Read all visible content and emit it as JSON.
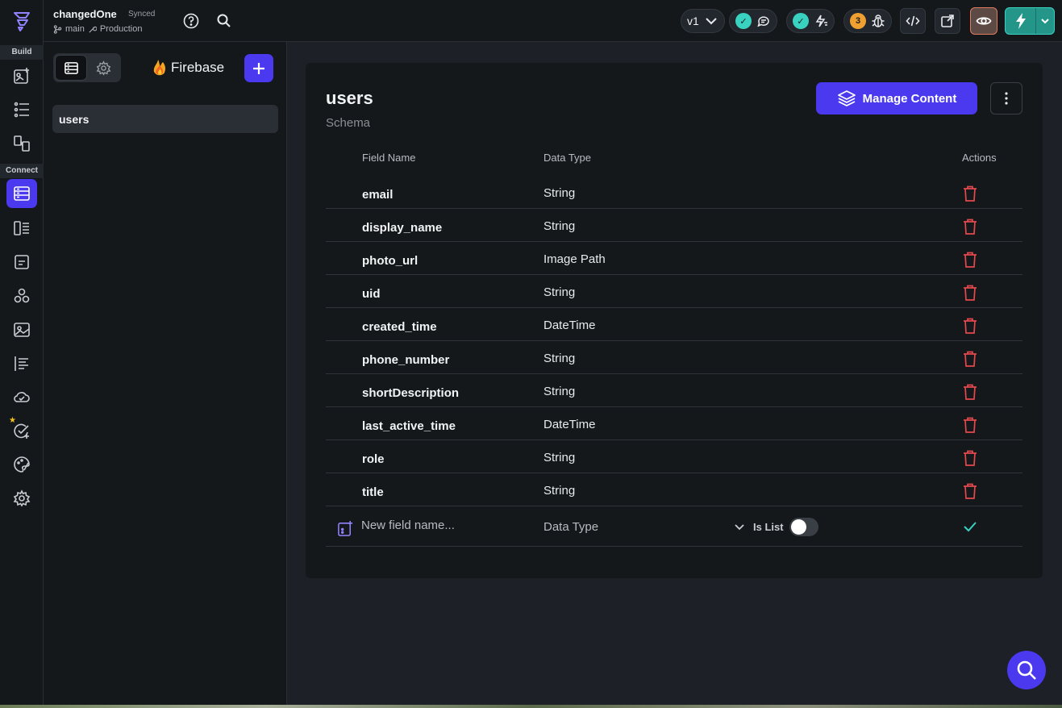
{
  "topbar": {
    "project_name": "changedOne",
    "sync_status": "Synced",
    "branch": "main",
    "environment": "Production",
    "version": "v1",
    "issues_count": "3"
  },
  "rail": {
    "build_label": "Build",
    "connect_label": "Connect"
  },
  "panel": {
    "provider": "Firebase",
    "collections": [
      "users"
    ]
  },
  "main": {
    "title": "users",
    "subtitle": "Schema",
    "manage_label": "Manage Content",
    "headers": {
      "field_name": "Field Name",
      "data_type": "Data Type",
      "actions": "Actions"
    },
    "fields": [
      {
        "name": "email",
        "type": "String"
      },
      {
        "name": "display_name",
        "type": "String"
      },
      {
        "name": "photo_url",
        "type": "Image Path"
      },
      {
        "name": "uid",
        "type": "String"
      },
      {
        "name": "created_time",
        "type": "DateTime"
      },
      {
        "name": "phone_number",
        "type": "String"
      },
      {
        "name": "shortDescription",
        "type": "String"
      },
      {
        "name": "last_active_time",
        "type": "DateTime"
      },
      {
        "name": "role",
        "type": "String"
      },
      {
        "name": "title",
        "type": "String"
      }
    ],
    "new_field": {
      "placeholder": "New field name...",
      "data_type_placeholder": "Data Type",
      "is_list_label": "Is List"
    }
  },
  "colors": {
    "accent": "#4b39ef",
    "teal": "#39d2c0",
    "delete": "#e5484d",
    "background": "#1d2127",
    "surface": "#14181b"
  }
}
